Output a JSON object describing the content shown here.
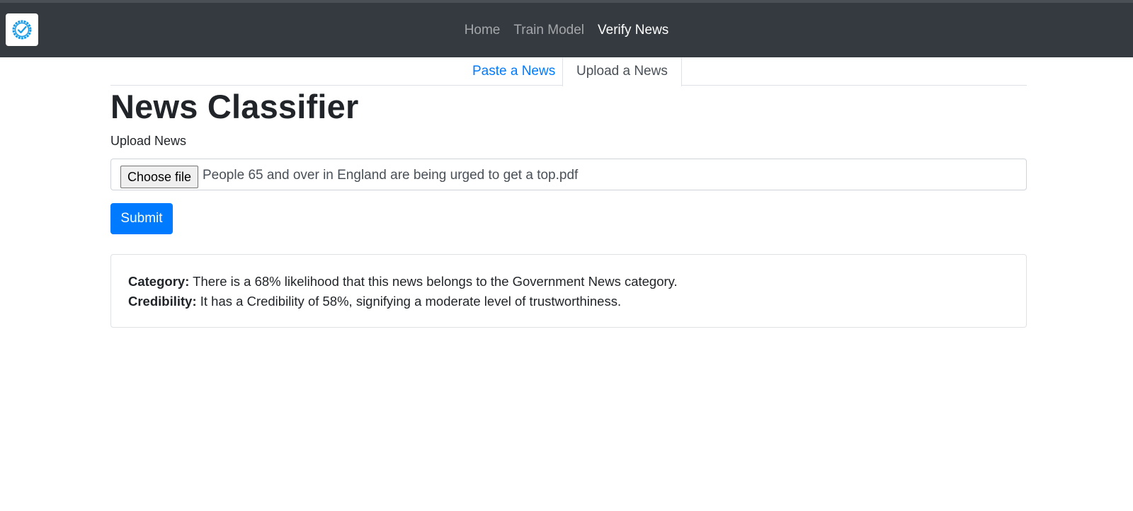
{
  "nav": {
    "links": [
      {
        "label": "Home",
        "active": false
      },
      {
        "label": "Train Model",
        "active": false
      },
      {
        "label": "Verify News",
        "active": true
      }
    ],
    "logo_icon": "verified-check-icon",
    "logo_color": "#1a9be6",
    "background": "#343a40"
  },
  "tabs": [
    {
      "label": "Paste a News",
      "active": false
    },
    {
      "label": "Upload a News",
      "active": true
    }
  ],
  "page": {
    "title": "News Classifier",
    "upload_label": "Upload News",
    "choose_file_label": "Choose file",
    "file_name": "People 65 and over in England are being urged to get a top.pdf",
    "submit_label": "Submit",
    "accent_color": "#007bff"
  },
  "result": {
    "category_label": "Category:",
    "category_text": "There is a 68% likelihood that this news belongs to the Government News category.",
    "credibility_label": "Credibility:",
    "credibility_text": "It has a Credibility of 58%, signifying a moderate level of trustworthiness."
  }
}
